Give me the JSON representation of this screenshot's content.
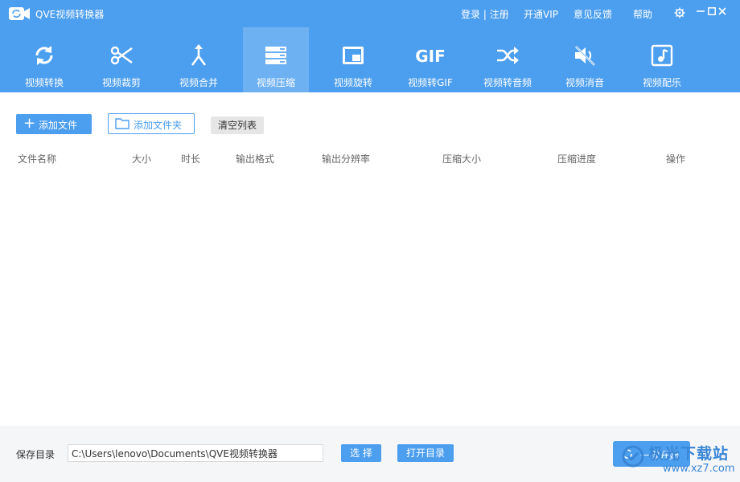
{
  "app": {
    "title": "QVE视频转换器"
  },
  "title_links": {
    "login_register": "登录 | 注册",
    "vip": "开通VIP",
    "feedback": "意见反馈",
    "help": "帮助"
  },
  "window_controls": {
    "settings_icon": "gear-icon",
    "minimize": "—",
    "maximize": "□",
    "close": "✕"
  },
  "toolbar": {
    "active_index": 3,
    "items": [
      {
        "label": "视频转换",
        "icon": "convert-icon"
      },
      {
        "label": "视频裁剪",
        "icon": "scissors-icon"
      },
      {
        "label": "视频合并",
        "icon": "merge-icon"
      },
      {
        "label": "视频压缩",
        "icon": "compress-icon"
      },
      {
        "label": "视频旋转",
        "icon": "rotate-icon"
      },
      {
        "label": "视频转GIF",
        "icon": "gif-icon"
      },
      {
        "label": "视频转音频",
        "icon": "shuffle-icon"
      },
      {
        "label": "视频消音",
        "icon": "mute-icon"
      },
      {
        "label": "视频配乐",
        "icon": "music-icon"
      }
    ],
    "gif_text": "GIF"
  },
  "actions": {
    "add_file": "添加文件",
    "add_folder": "添加文件夹",
    "clear_list": "清空列表"
  },
  "table": {
    "columns": [
      "文件名称",
      "大小",
      "时长",
      "输出格式",
      "输出分辨率",
      "压缩大小",
      "压缩进度",
      "操作"
    ],
    "rows": []
  },
  "bottom": {
    "save_dir_label": "保存目录",
    "save_path": "C:\\Users\\lenovo\\Documents\\QVE视频转换器",
    "choose": "选 择",
    "open_dir": "打开目录",
    "start": "一键开始"
  },
  "watermark": {
    "text": "极光下载站",
    "url": "www.xz7.com"
  },
  "colors": {
    "primary": "#4c9eef",
    "active_tab": "#6eb1f3",
    "bottom_bg": "#f5f6f8"
  }
}
